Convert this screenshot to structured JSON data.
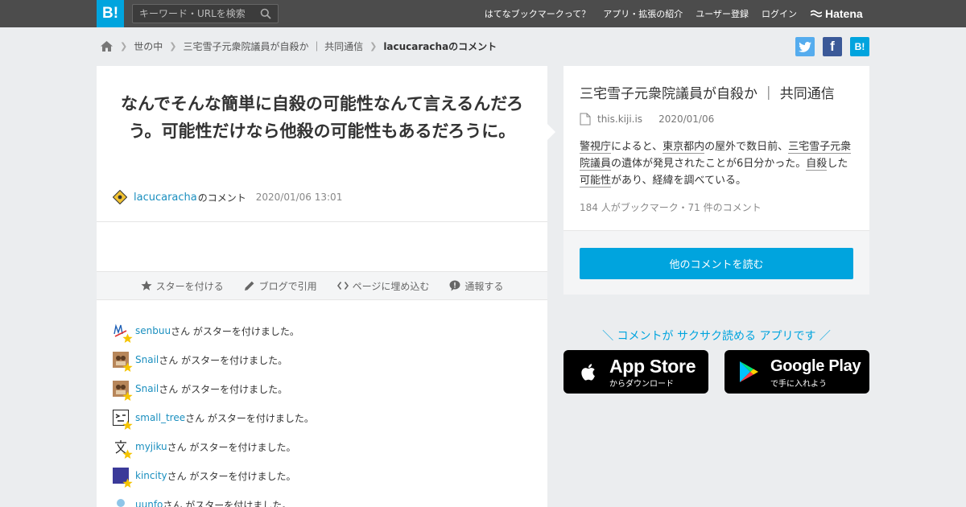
{
  "header": {
    "logo": "B!",
    "search_placeholder": "キーワード・URLを検索",
    "nav": [
      "はてなブックマークって？",
      "アプリ・拡張の紹介",
      "ユーザー登録",
      "ログイン"
    ],
    "brand": "Hatena"
  },
  "breadcrumb": {
    "items": [
      "世の中",
      "三宅雪子元衆院議員が自殺か ｜ 共同通信",
      "lacucarachaのコメント"
    ]
  },
  "share": {
    "twitter": "t",
    "facebook": "f",
    "hatena": "B!"
  },
  "comment": {
    "text": "なんでそんな簡単に自殺の可能性なんて言えるんだろう。可能性だけなら他殺の可能性もあるだろうに。",
    "user": "lacucaracha",
    "suffix": "のコメント",
    "date": "2020/01/06 13:01"
  },
  "actions": {
    "star": "スターを付ける",
    "blog": "ブログで引用",
    "embed": "ページに埋め込む",
    "report": "通報する"
  },
  "stars": [
    {
      "user": "senbuu",
      "text": "さん がスターを付けました。"
    },
    {
      "user": "Snail",
      "text": "さん がスターを付けました。"
    },
    {
      "user": "Snail",
      "text": "さん がスターを付けました。"
    },
    {
      "user": "small_tree",
      "text": "さん がスターを付けました。"
    },
    {
      "user": "myjiku",
      "text": "さん がスターを付けました。"
    },
    {
      "user": "kincity",
      "text": "さん がスターを付けました。"
    },
    {
      "user": "uunfo",
      "text": "さん がスターを付けました。"
    }
  ],
  "entry": {
    "title": "三宅雪子元衆院議員が自殺か ｜ 共同通信",
    "domain": "this.kiji.is",
    "date": "2020/01/06",
    "desc": {
      "p1": "警視庁",
      "p2": "によると、",
      "p3": "東京都内",
      "p4": "の屋外で数日前、",
      "p5": "三宅雪子元衆院議員",
      "p6": "の遺体が発見されたことが6日分かった。",
      "p7": "自殺",
      "p8": "した",
      "p9": "可能性",
      "p10": "があり、経緯を調べている。"
    },
    "stats": "184 人がブックマーク・71 件のコメント",
    "button": "他のコメントを読む"
  },
  "promo": {
    "text": "＼ コメントが サクサク読める アプリです ／",
    "appstore_big": "App Store",
    "appstore_small": "からダウンロード",
    "googleplay_big": "Google Play",
    "googleplay_small": "で手に入れよう"
  },
  "colors": {
    "accent": "#00a4de",
    "link": "#1a8fbf",
    "header": "#4c4c4c",
    "twitter": "#55acee",
    "facebook": "#3b5998",
    "star": "#f5c400"
  }
}
